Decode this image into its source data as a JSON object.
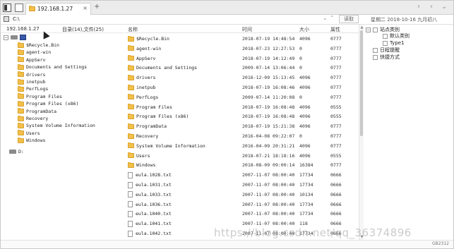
{
  "tabs": [
    {
      "label": "192.168.1.27"
    }
  ],
  "address": {
    "path": "C:\\",
    "read_button": "读取"
  },
  "date_info": "星期二 2018-10-16 九月初八",
  "tree": {
    "host": "192.168.1.27",
    "dir_summary": "目录(14),文件(25)",
    "items": [
      {
        "label": "$Recycle.Bin"
      },
      {
        "label": "agent-win"
      },
      {
        "label": "AppServ"
      },
      {
        "label": "Documents and Settings"
      },
      {
        "label": "drivers"
      },
      {
        "label": "inetpub"
      },
      {
        "label": "PerfLogs"
      },
      {
        "label": "Program Files"
      },
      {
        "label": "Program Files (x86)"
      },
      {
        "label": "ProgramData"
      },
      {
        "label": "Recovery"
      },
      {
        "label": "System Volume Information"
      },
      {
        "label": "Users"
      },
      {
        "label": "Windows"
      }
    ],
    "drive_d": "D:"
  },
  "list": {
    "headers": {
      "name": "名称",
      "time": "时间",
      "size": "大小",
      "attr": "属性"
    },
    "rows": [
      {
        "icon": "folder-icon",
        "name": "$Recycle.Bin",
        "time": "2018-07-19 14:48:54",
        "size": "4096",
        "attr": "0777"
      },
      {
        "icon": "folder-icon",
        "name": "agent-win",
        "time": "2018-07-23 12:27:53",
        "size": "0",
        "attr": "0777"
      },
      {
        "icon": "folder-icon",
        "name": "AppServ",
        "time": "2018-07-19 14:12:49",
        "size": "0",
        "attr": "0777"
      },
      {
        "icon": "folder-icon",
        "name": "Documents and Settings",
        "time": "2009-07-14 13:06:44",
        "size": "0",
        "attr": "0777"
      },
      {
        "icon": "folder-icon",
        "name": "drivers",
        "time": "2016-12-09 15:13:45",
        "size": "4096",
        "attr": "0777"
      },
      {
        "icon": "folder-icon",
        "name": "inetpub",
        "time": "2018-07-19 16:08:46",
        "size": "4096",
        "attr": "0777"
      },
      {
        "icon": "folder-icon",
        "name": "PerfLogs",
        "time": "2009-07-14 11:20:08",
        "size": "0",
        "attr": "0777"
      },
      {
        "icon": "folder-icon",
        "name": "Program Files",
        "time": "2018-07-19 16:08:48",
        "size": "4096",
        "attr": "0555"
      },
      {
        "icon": "folder-icon",
        "name": "Program Files (x86)",
        "time": "2018-07-19 16:08:48",
        "size": "4096",
        "attr": "0555"
      },
      {
        "icon": "folder-icon",
        "name": "ProgramData",
        "time": "2018-07-19 15:21:38",
        "size": "4096",
        "attr": "0777"
      },
      {
        "icon": "folder-icon",
        "name": "Recovery",
        "time": "2016-04-08 09:22:07",
        "size": "0",
        "attr": "0777"
      },
      {
        "icon": "folder-icon",
        "name": "System Volume Information",
        "time": "2016-04-09 20:31:21",
        "size": "4096",
        "attr": "0777"
      },
      {
        "icon": "folder-icon",
        "name": "Users",
        "time": "2018-07-21 18:18:16",
        "size": "4096",
        "attr": "0555"
      },
      {
        "icon": "folder-icon",
        "name": "Windows",
        "time": "2018-08-09 09:00:14",
        "size": "16384",
        "attr": "0777"
      },
      {
        "icon": "file-icon",
        "name": "eula.1028.txt",
        "time": "2007-11-07 08:00:40",
        "size": "17734",
        "attr": "0666"
      },
      {
        "icon": "file-icon",
        "name": "eula.1031.txt",
        "time": "2007-11-07 08:00:40",
        "size": "17734",
        "attr": "0666"
      },
      {
        "icon": "file-icon",
        "name": "eula.1033.txt",
        "time": "2007-11-07 08:00:40",
        "size": "10134",
        "attr": "0666"
      },
      {
        "icon": "file-icon",
        "name": "eula.1036.txt",
        "time": "2007-11-07 08:00:40",
        "size": "17734",
        "attr": "0666"
      },
      {
        "icon": "file-icon",
        "name": "eula.1040.txt",
        "time": "2007-11-07 08:00:40",
        "size": "17734",
        "attr": "0666"
      },
      {
        "icon": "file-icon",
        "name": "eula.1041.txt",
        "time": "2007-11-07 08:00:40",
        "size": "118",
        "attr": "0666"
      },
      {
        "icon": "file-icon",
        "name": "eula.1042.txt",
        "time": "2007-11-07 08:00:40",
        "size": "17734",
        "attr": "0666"
      }
    ]
  },
  "right_panel": {
    "items": [
      {
        "label": "站点类别"
      },
      {
        "label": "默认类别"
      },
      {
        "label": "Type1"
      },
      {
        "label": "日程提醒"
      },
      {
        "label": "快捷方式"
      }
    ]
  },
  "status": {
    "code": "GB2312"
  },
  "watermark": "https://blog.csdn.net/qq_36374896"
}
